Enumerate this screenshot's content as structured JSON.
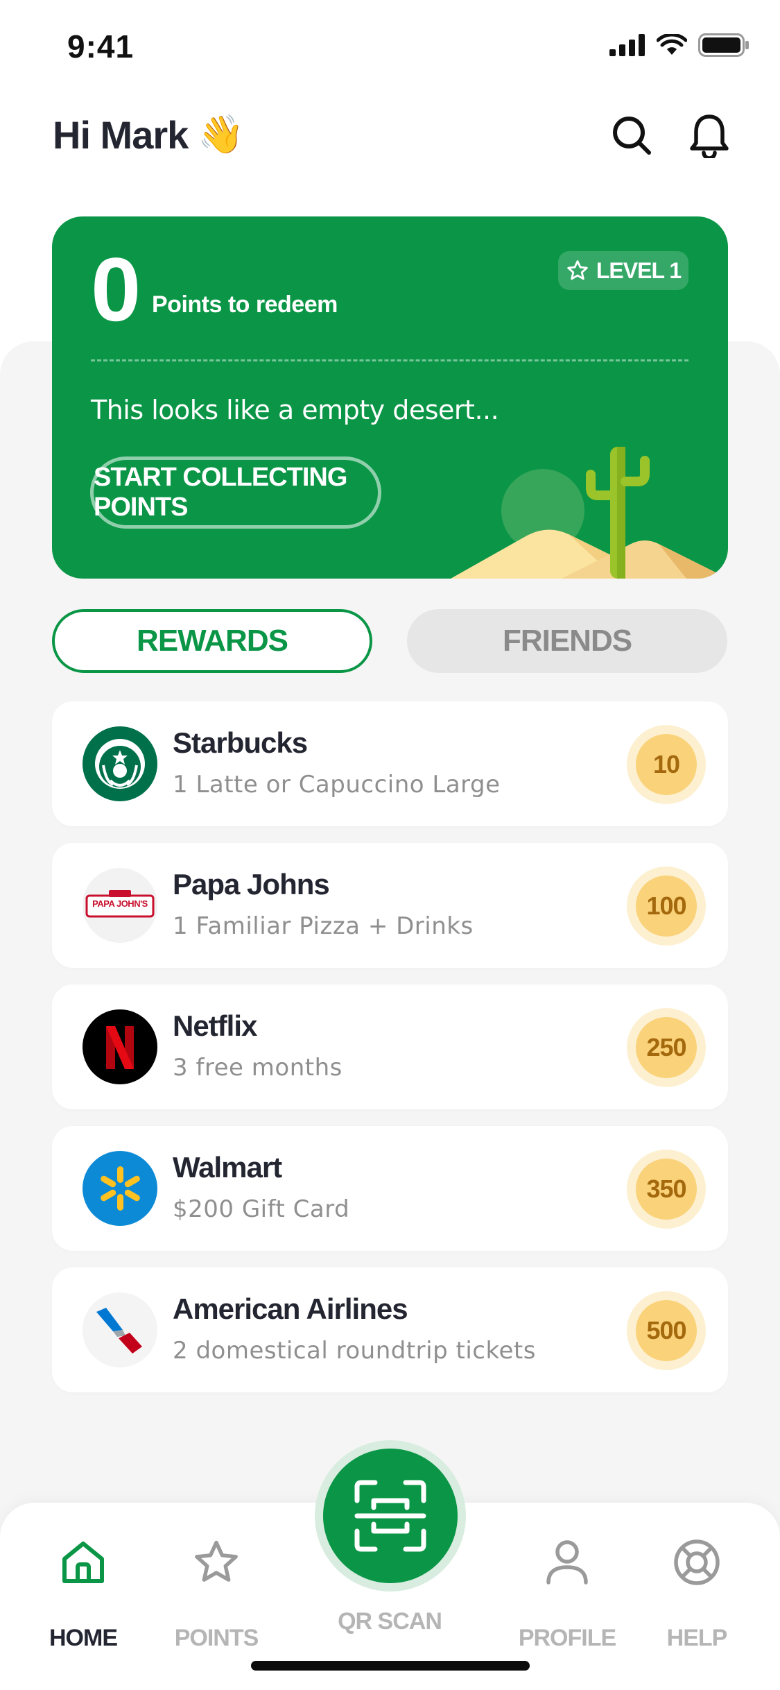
{
  "status_bar": {
    "time": "9:41"
  },
  "header": {
    "greeting": "Hi Mark",
    "wave_emoji": "👋"
  },
  "points_card": {
    "points": "0",
    "points_label": "Points to redeem",
    "level": "LEVEL 1",
    "empty_message": "This looks like a empty desert...",
    "cta_label": "START COLLECTING POINTS"
  },
  "tabs": [
    {
      "label": "REWARDS",
      "active": true
    },
    {
      "label": "FRIENDS",
      "active": false
    }
  ],
  "rewards": [
    {
      "name": "Starbucks",
      "description": "1 Latte or Capuccino Large",
      "points": "10",
      "logo": "starbucks-logo"
    },
    {
      "name": "Papa Johns",
      "description": "1 Familiar Pizza + Drinks",
      "points": "100",
      "logo": "papa-johns-logo"
    },
    {
      "name": "Netflix",
      "description": "3 free months",
      "points": "250",
      "logo": "netflix-logo"
    },
    {
      "name": "Walmart",
      "description": "$200 Gift Card",
      "points": "350",
      "logo": "walmart-logo"
    },
    {
      "name": "American Airlines",
      "description": "2 domestical roundtrip tickets",
      "points": "500",
      "logo": "american-airlines-logo"
    }
  ],
  "papa_johns_logo_text": "PAPA JOHN'S",
  "bottom_nav": [
    {
      "label": "HOME",
      "icon": "home-icon",
      "active": true
    },
    {
      "label": "POINTS",
      "icon": "star-icon",
      "active": false
    },
    {
      "label": "QR SCAN",
      "icon": "qr-scan-icon",
      "active": false
    },
    {
      "label": "PROFILE",
      "icon": "user-icon",
      "active": false
    },
    {
      "label": "HELP",
      "icon": "lifebuoy-icon",
      "active": false
    }
  ],
  "colors": {
    "brand_green": "#0a9646",
    "coin_gold": "#fad27a",
    "background_gray": "#f5f5f5"
  }
}
